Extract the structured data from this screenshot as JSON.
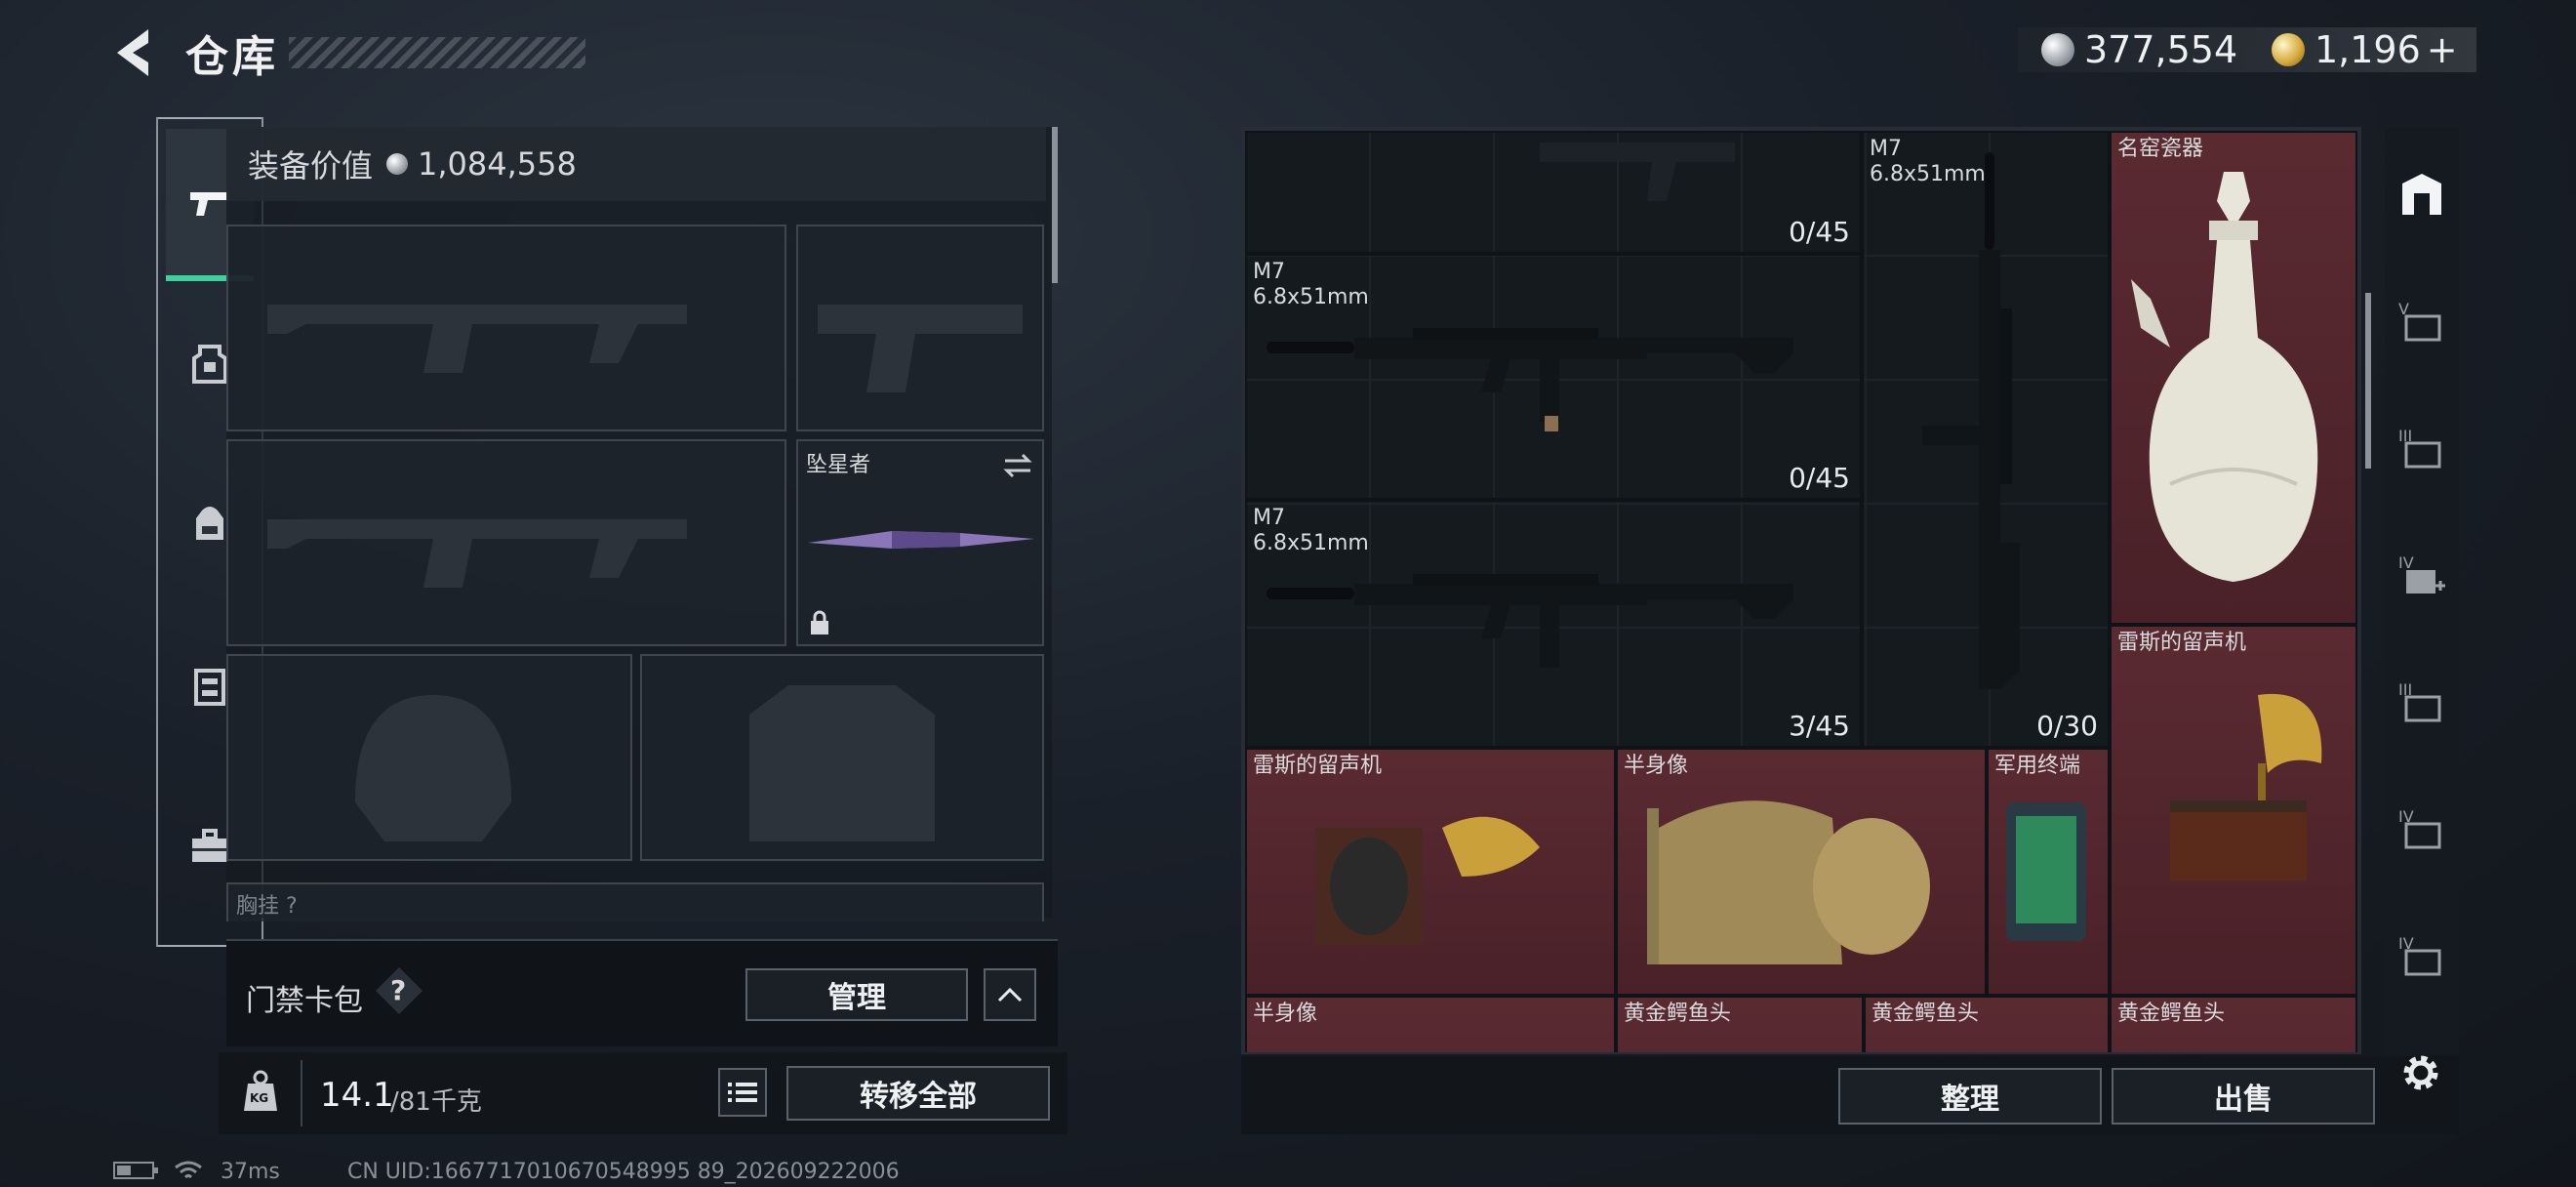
{
  "header": {
    "title": "仓库",
    "silver_amount": "377,554",
    "gold_amount": "1,196",
    "gold_plus": "+"
  },
  "equipment": {
    "value_label": "装备价值",
    "value_amount": "1,084,558",
    "melee_name": "坠星者",
    "chest_label_partial": "胸挂 ?"
  },
  "card_pack": {
    "label": "门禁卡包",
    "help": "?",
    "manage_label": "管理"
  },
  "weight": {
    "icon_text": "KG",
    "current": "14.1",
    "max": "/81千克",
    "transfer_all_label": "转移全部"
  },
  "inventory": {
    "items": [
      {
        "name": "",
        "caliber": "",
        "count": "0/45"
      },
      {
        "name": "M7",
        "caliber": "6.8x51mm",
        "count": "0/45"
      },
      {
        "name": "M7",
        "caliber": "6.8x51mm",
        "count": "3/45"
      },
      {
        "name": "M7",
        "caliber": "6.8x51mm",
        "count": "0/30"
      },
      {
        "name": "名窑瓷器",
        "caliber": "",
        "count": ""
      },
      {
        "name": "雷斯的留声机",
        "caliber": "",
        "count": ""
      },
      {
        "name": "雷斯的留声机",
        "caliber": "",
        "count": ""
      },
      {
        "name": "半身像",
        "caliber": "",
        "count": ""
      },
      {
        "name": "军用终端",
        "caliber": "",
        "count": ""
      },
      {
        "name": "半身像",
        "caliber": "",
        "count": ""
      },
      {
        "name": "黄金鳄鱼头",
        "caliber": "",
        "count": ""
      },
      {
        "name": "黄金鳄鱼头",
        "caliber": "",
        "count": ""
      },
      {
        "name": "黄金鳄鱼头",
        "caliber": "",
        "count": ""
      }
    ],
    "sort_label": "整理",
    "sell_label": "出售"
  },
  "sidebar_tabs": [
    "home-storage",
    "V",
    "III",
    "IV+",
    "III",
    "IV",
    "IV"
  ],
  "status_bar": {
    "ping": "37ms",
    "uid": "CN UID:1667717010670548995 89_202609222006"
  },
  "colors": {
    "accent": "#3fd19a",
    "rare_bg": "#5a2a31",
    "panel_bg": "#181d23"
  }
}
